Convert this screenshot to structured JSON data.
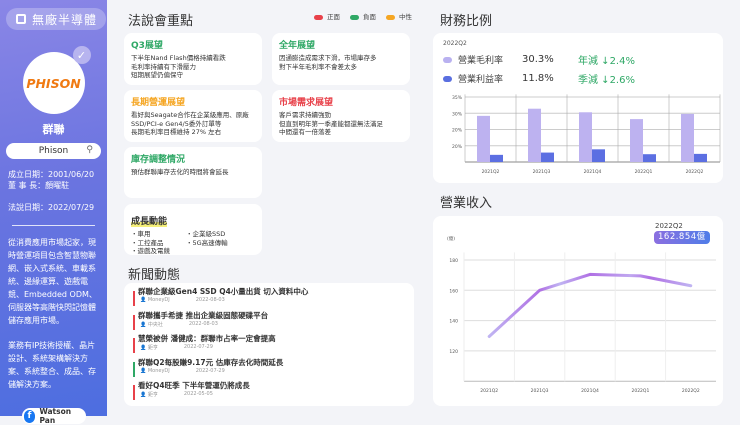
{
  "sidebar": {
    "category": "無廠半導體",
    "logo_text": "PHISON",
    "company": "群聯",
    "search_value": "Phison",
    "founded": "成立日期：2001/06/20",
    "chairman": "董 事 長：顏曜駐",
    "conference_date": "法說日期：2022/07/29",
    "desc1": "從消費應用市場起家，現時營運項目包含智慧物聯網、嵌入式系統、車載系統、邊緣運算、遊戲電競、Embedded ODM、伺服器等高階快閃記憶體儲存應用市場。",
    "desc2": "業務有IP技術授權、晶片設計、系統架構解決方案、系統整合、成品、存儲解決方案。",
    "author": "Watson Pan"
  },
  "highlights": {
    "title": "法說會重點",
    "legend": [
      {
        "label": "正面",
        "color": "#e8414a"
      },
      {
        "label": "負面",
        "color": "#2fa866"
      },
      {
        "label": "中性",
        "color": "#f5a623"
      }
    ],
    "cards": [
      {
        "title": "Q3展望",
        "color": "#2fa866",
        "body": "下半年Nand Flash價格持續看跌\n毛利率持續有下滑壓力\n短期展望仍偏保守"
      },
      {
        "title": "全年展望",
        "color": "#2fa866",
        "body": "因通膨造成需求下滑，市場庫存多\n對下半年毛利率不會差太多"
      },
      {
        "title": "長期營運展望",
        "color": "#f5a623",
        "body": "看好與Seagate合作在企業級應用、原廠\nSSD/PCI-e Gen4/5委外訂單等\n長期毛利率目標維持 27% 左右"
      },
      {
        "title": "市場需求展望",
        "color": "#e8414a",
        "body": "客戶需求持續強勁\n但直到明年第一季產能都還無法滿足\n中間還有一倍落差"
      },
      {
        "title": "庫存調整情況",
        "color": "#2fa866",
        "body": "預估群聯庫存去化的時間將會延長"
      }
    ],
    "growth": {
      "title": "成長動能",
      "items": [
        "・車用",
        "・5G高速傳輸",
        "・企業級SSD",
        "・遊戲及電競",
        "・工控產品"
      ]
    }
  },
  "news": {
    "title": "新聞動態",
    "items": [
      {
        "title": "群聯企業級Gen4 SSD Q4小量出貨 切入資料中心",
        "source": "MoneyDJ",
        "date": "2022-08-03",
        "color": "#e8414a"
      },
      {
        "title": "群聯攜手希捷 推出企業級固態硬碟平台",
        "source": "中央社",
        "date": "2022-08-03",
        "color": "#e8414a"
      },
      {
        "title": "慧榮被併 潘健成：群聯市占率一定會提高",
        "source": "鉅亨",
        "date": "2022-07-29",
        "color": "#e8414a"
      },
      {
        "title": "群聯Q2每股賺9.17元 估庫存去化時間延長",
        "source": "MoneyDJ",
        "date": "2022-07-29",
        "color": "#2fa866"
      },
      {
        "title": "看好Q4旺季 下半年營運仍將成長",
        "source": "鉅亨",
        "date": "2022-05-05",
        "color": "#e8414a"
      }
    ]
  },
  "finance": {
    "title": "財務比例",
    "period": "2022Q2",
    "rows": [
      {
        "label": "營業毛利率",
        "value": "30.3%",
        "change_label": "年減",
        "change": "2.4%",
        "color": "#b9b1f0"
      },
      {
        "label": "營業利益率",
        "value": "11.8%",
        "change_label": "季減",
        "change": "2.6%",
        "color": "#5a6fe0"
      }
    ]
  },
  "revenue": {
    "title": "營業收入",
    "tag_period": "2022Q2",
    "tag_value": "162.854億",
    "unit": "(億)"
  },
  "chart_data": [
    {
      "type": "bar",
      "categories": [
        "2021Q2",
        "2021Q3",
        "2021Q4",
        "2022Q1",
        "2022Q2"
      ],
      "series": [
        {
          "name": "營業毛利率",
          "values": [
            29.2,
            31.4,
            30.3,
            28.2,
            29.8
          ]
        },
        {
          "name": "營業利益率",
          "values": [
            17.2,
            17.9,
            18.9,
            17.4,
            17.5
          ]
        }
      ],
      "yticks": [
        "20%",
        "20%",
        "30%",
        "35%"
      ],
      "ylim": [
        15,
        36
      ],
      "grid": true
    },
    {
      "type": "line",
      "categories": [
        "2021Q2",
        "2021Q3",
        "2021Q4",
        "2022Q1",
        "2022Q2"
      ],
      "series": [
        {
          "name": "營業收入",
          "values": [
            129.5,
            160,
            170.5,
            169.5,
            163
          ]
        }
      ],
      "yticks": [
        120,
        140,
        160,
        180
      ],
      "ylim": [
        100,
        185
      ],
      "ylabel": "(億)",
      "grid": true
    }
  ]
}
